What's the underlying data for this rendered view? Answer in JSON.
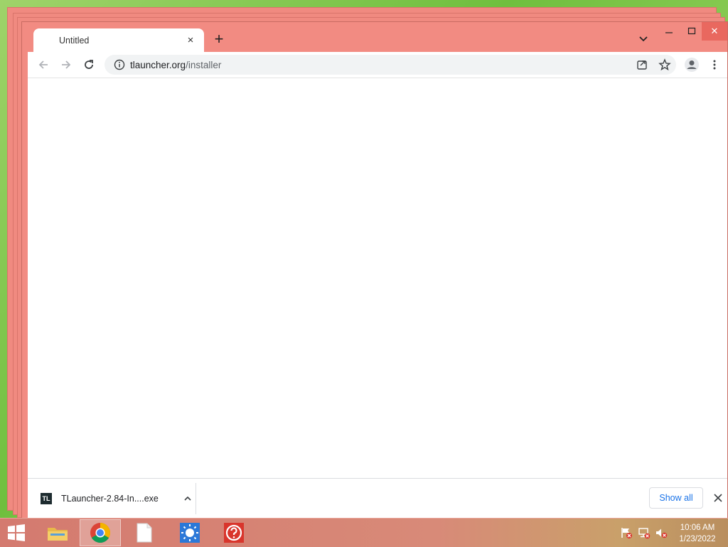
{
  "browser": {
    "tab": {
      "title": "Untitled",
      "close_glyph": "×"
    },
    "new_tab_glyph": "+",
    "address": {
      "host": "tlauncher.org",
      "path": "/installer"
    },
    "window_controls": {
      "close_glyph": "✕"
    }
  },
  "download": {
    "icon_text": "TL",
    "filename": "TLauncher-2.84-In....exe",
    "show_all_label": "Show all"
  },
  "taskbar": {
    "time": "10:06 AM",
    "date": "1/23/2022"
  },
  "colors": {
    "frame": "#f28b82",
    "link_blue": "#1a73e8",
    "taskbar": "#d47a6f"
  },
  "icons": {
    "back": "back-arrow-icon",
    "forward": "forward-arrow-icon",
    "reload": "reload-icon",
    "info": "info-icon",
    "share": "share-icon",
    "bookmark": "star-icon",
    "profile": "profile-icon",
    "menu": "kebab-menu-icon"
  }
}
